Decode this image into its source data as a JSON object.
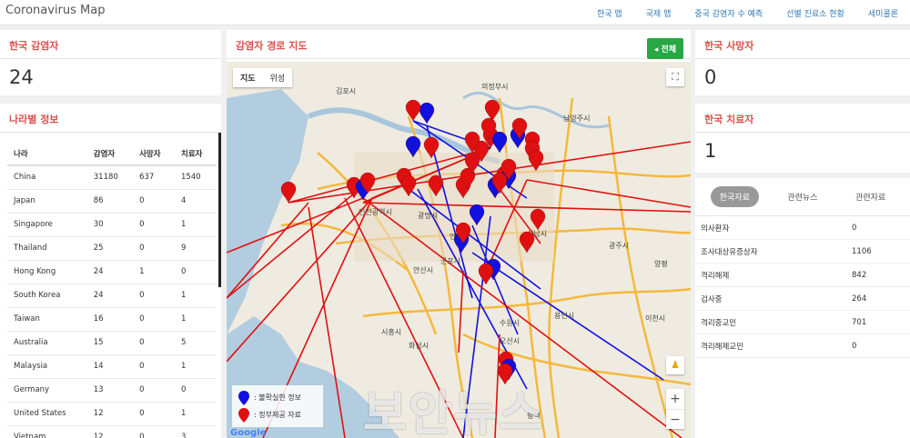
{
  "header": {
    "brand": "Coronavirus Map",
    "nav": [
      "한국 맵",
      "국제 맵",
      "중국 감염자 수 예측",
      "선별 진료소 현황",
      "세미콜론"
    ]
  },
  "korea_cases": {
    "title": "한국 감염자",
    "value": "24"
  },
  "by_country": {
    "title": "나라별 정보",
    "headers": [
      "나라",
      "감염자",
      "사망자",
      "치료자"
    ],
    "rows": [
      [
        "China",
        "31180",
        "637",
        "1540"
      ],
      [
        "Japan",
        "86",
        "0",
        "4"
      ],
      [
        "Singapore",
        "30",
        "0",
        "1"
      ],
      [
        "Thailand",
        "25",
        "0",
        "9"
      ],
      [
        "Hong Kong",
        "24",
        "1",
        "0"
      ],
      [
        "South Korea",
        "24",
        "0",
        "1"
      ],
      [
        "Taiwan",
        "16",
        "0",
        "1"
      ],
      [
        "Australia",
        "15",
        "0",
        "5"
      ],
      [
        "Malaysia",
        "14",
        "0",
        "1"
      ],
      [
        "Germany",
        "13",
        "0",
        "0"
      ],
      [
        "United States",
        "12",
        "0",
        "1"
      ],
      [
        "Vietnam",
        "12",
        "0",
        "3"
      ]
    ]
  },
  "map": {
    "title": "감염자 경로 지도",
    "all_button": "전체",
    "map_types": [
      "지도",
      "위성"
    ],
    "zoom_in": "+",
    "zoom_out": "−",
    "legend_unconfirmed": ": 불확실한 정보",
    "legend_government": ": 정부제공 자료",
    "watermark": "보안뉴스",
    "google": "Google",
    "colors": {
      "unconfirmed": "#1010e0",
      "government": "#e01010"
    },
    "place_labels": [
      "김포시",
      "의정부시",
      "남양주시",
      "인천광역시",
      "광명시",
      "안양시",
      "군포시",
      "안산시",
      "수원시",
      "성남시",
      "용인시",
      "화성시",
      "오산시",
      "광주시",
      "이천시",
      "양평",
      "시흥시",
      "평택"
    ]
  },
  "korea_deaths": {
    "title": "한국 사망자",
    "value": "0"
  },
  "korea_recovered": {
    "title": "한국 치료자",
    "value": "1"
  },
  "korea_info": {
    "tabs": [
      "한국자료",
      "관련뉴스",
      "관련자료"
    ],
    "rows": [
      {
        "label": "의사환자",
        "value": "0"
      },
      {
        "label": "조사대상유증상자",
        "value": "1106"
      },
      {
        "label": "격리해제",
        "value": "842"
      },
      {
        "label": "검사중",
        "value": "264"
      },
      {
        "label": "격리중교민",
        "value": "701"
      },
      {
        "label": "격리해제교민",
        "value": "0"
      }
    ]
  }
}
